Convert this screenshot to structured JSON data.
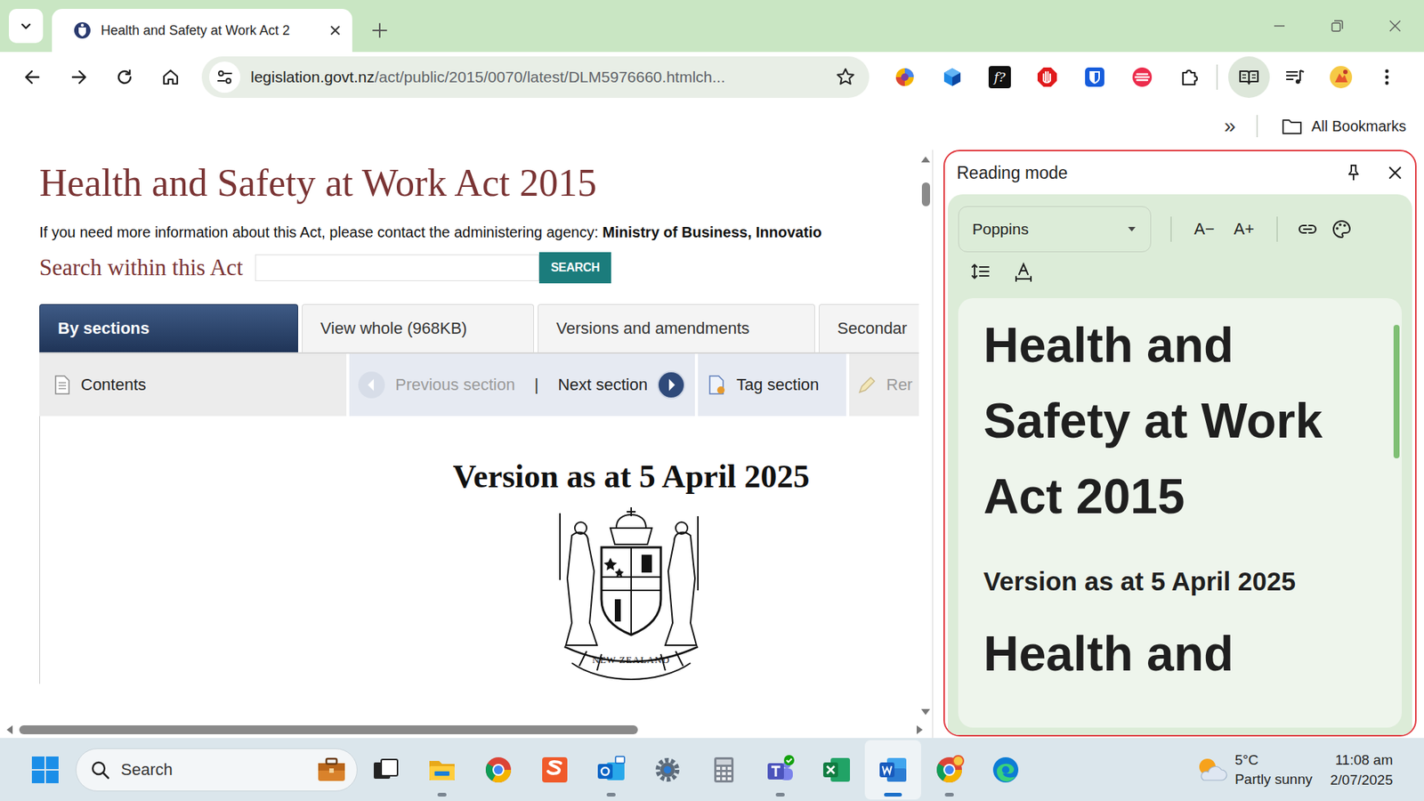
{
  "browser": {
    "tabs": [
      {
        "title": "Health and Safety at Work Act 2",
        "selected": true
      }
    ],
    "address": {
      "host": "legislation.govt.nz",
      "path": "/act/public/2015/0070/latest/DLM5976660.htmlch..."
    },
    "extensions": [
      {
        "kind": "orb"
      },
      {
        "kind": "cube"
      },
      {
        "kind": "formula",
        "glyph": "f?"
      },
      {
        "kind": "stop"
      },
      {
        "kind": "shield"
      },
      {
        "kind": "stripes"
      },
      {
        "kind": "puzzle"
      }
    ],
    "reading_mode_open": true,
    "bookmarks": {
      "overflow": "»",
      "folder": "All Bookmarks"
    }
  },
  "page": {
    "title": "Health and Safety at Work Act 2015",
    "info": "If you need more information about this Act, please contact the administering agency: ",
    "agency": "Ministry of Business, Innovatio",
    "search_label": "Search within this Act",
    "search_button": "SEARCH",
    "tabs": [
      {
        "label": "By sections",
        "selected": true
      },
      {
        "label": "View whole (968KB)",
        "selected": false
      },
      {
        "label": "Versions and amendments",
        "selected": false
      },
      {
        "label": "Secondar",
        "selected": false
      }
    ],
    "tool_groups": [
      [
        {
          "kind": "contents",
          "label": "Contents",
          "disabled": false
        }
      ],
      [
        {
          "kind": "previous",
          "label": "Previous section",
          "disabled": true
        },
        {
          "kind": "next",
          "label": "Next section",
          "disabled": false
        }
      ],
      [
        {
          "kind": "tag",
          "label": "Tag section",
          "disabled": false
        }
      ],
      [
        {
          "kind": "remove",
          "label": "Rer",
          "disabled": true
        }
      ]
    ],
    "separator": "|",
    "version": "Version as at 5 April 2025",
    "emblem_motto": "NEW ZEALAND"
  },
  "reading_mode": {
    "title": "Reading mode",
    "font": "Poppins",
    "size_buttons": [
      "A−",
      "A+"
    ],
    "heading": "Health and Safety at Work Act 2015",
    "subheading": "Version as at 5 April 2025",
    "next_heading": "Health and"
  },
  "taskbar": {
    "search": "Search",
    "apps": [
      {
        "kind": "taskview",
        "running": false,
        "active": false
      },
      {
        "kind": "explorer",
        "running": true,
        "active": false
      },
      {
        "kind": "chrome",
        "running": false,
        "active": false
      },
      {
        "kind": "slides",
        "running": false,
        "active": false
      },
      {
        "kind": "outlook",
        "running": true,
        "active": false
      },
      {
        "kind": "settings",
        "running": false,
        "active": false
      },
      {
        "kind": "calculator",
        "running": false,
        "active": false
      },
      {
        "kind": "teams",
        "running": true,
        "active": false
      },
      {
        "kind": "excel",
        "running": false,
        "active": false
      },
      {
        "kind": "word",
        "running": true,
        "active": true
      },
      {
        "kind": "chrome-profile",
        "running": true,
        "active": false
      },
      {
        "kind": "edge",
        "running": false,
        "active": false
      }
    ],
    "weather": {
      "temperature": "5°C",
      "condition": "Partly sunny"
    },
    "time": "11:08 am",
    "date": "2/07/2025"
  }
}
